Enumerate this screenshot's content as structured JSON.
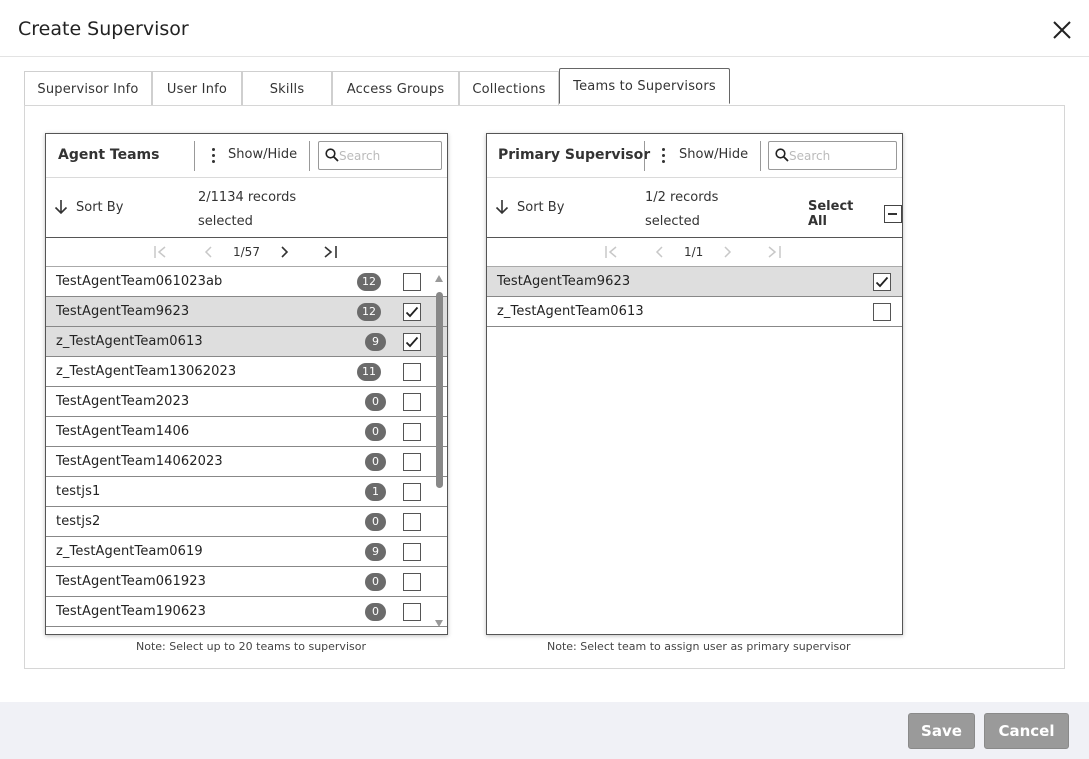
{
  "dialog": {
    "title": "Create Supervisor"
  },
  "tabs": [
    {
      "label": "Supervisor Info"
    },
    {
      "label": "User Info"
    },
    {
      "label": "Skills"
    },
    {
      "label": "Access Groups"
    },
    {
      "label": "Collections"
    },
    {
      "label": "Teams to Supervisors",
      "active": true
    }
  ],
  "left_panel": {
    "title": "Agent Teams",
    "show_hide": "Show/Hide",
    "search_placeholder": "Search",
    "sort_label": "Sort By",
    "records_line1": "2/1134 records",
    "records_line2": "selected",
    "page": "1/57",
    "rows": [
      {
        "name": "TestAgentTeam061023ab",
        "count": "12",
        "checked": false
      },
      {
        "name": "TestAgentTeam9623",
        "count": "12",
        "checked": true
      },
      {
        "name": "z_TestAgentTeam0613",
        "count": "9",
        "checked": true
      },
      {
        "name": "z_TestAgentTeam13062023",
        "count": "11",
        "checked": false
      },
      {
        "name": "TestAgentTeam2023",
        "count": "0",
        "checked": false
      },
      {
        "name": "TestAgentTeam1406",
        "count": "0",
        "checked": false
      },
      {
        "name": "TestAgentTeam14062023",
        "count": "0",
        "checked": false
      },
      {
        "name": "testjs1",
        "count": "1",
        "checked": false
      },
      {
        "name": "testjs2",
        "count": "0",
        "checked": false
      },
      {
        "name": "z_TestAgentTeam0619",
        "count": "9",
        "checked": false
      },
      {
        "name": "TestAgentTeam061923",
        "count": "0",
        "checked": false
      },
      {
        "name": "TestAgentTeam190623",
        "count": "0",
        "checked": false
      }
    ],
    "note": "Note: Select up to 20 teams to supervisor"
  },
  "right_panel": {
    "title": "Primary Supervisor",
    "show_hide": "Show/Hide",
    "search_placeholder": "Search",
    "sort_label": "Sort By",
    "records_line1": "1/2 records",
    "records_line2": "selected",
    "select_all": "Select All",
    "page": "1/1",
    "rows": [
      {
        "name": "TestAgentTeam9623",
        "checked": true
      },
      {
        "name": "z_TestAgentTeam0613",
        "checked": false
      }
    ],
    "note": "Note: Select team to assign user as primary supervisor"
  },
  "footer": {
    "save_label": "Save",
    "cancel_label": "Cancel"
  },
  "colors": {
    "badge": "#6b6b6b",
    "selected_row": "#dedede",
    "button": "#9a9a9a",
    "footer_bg": "#f0f1f6"
  }
}
